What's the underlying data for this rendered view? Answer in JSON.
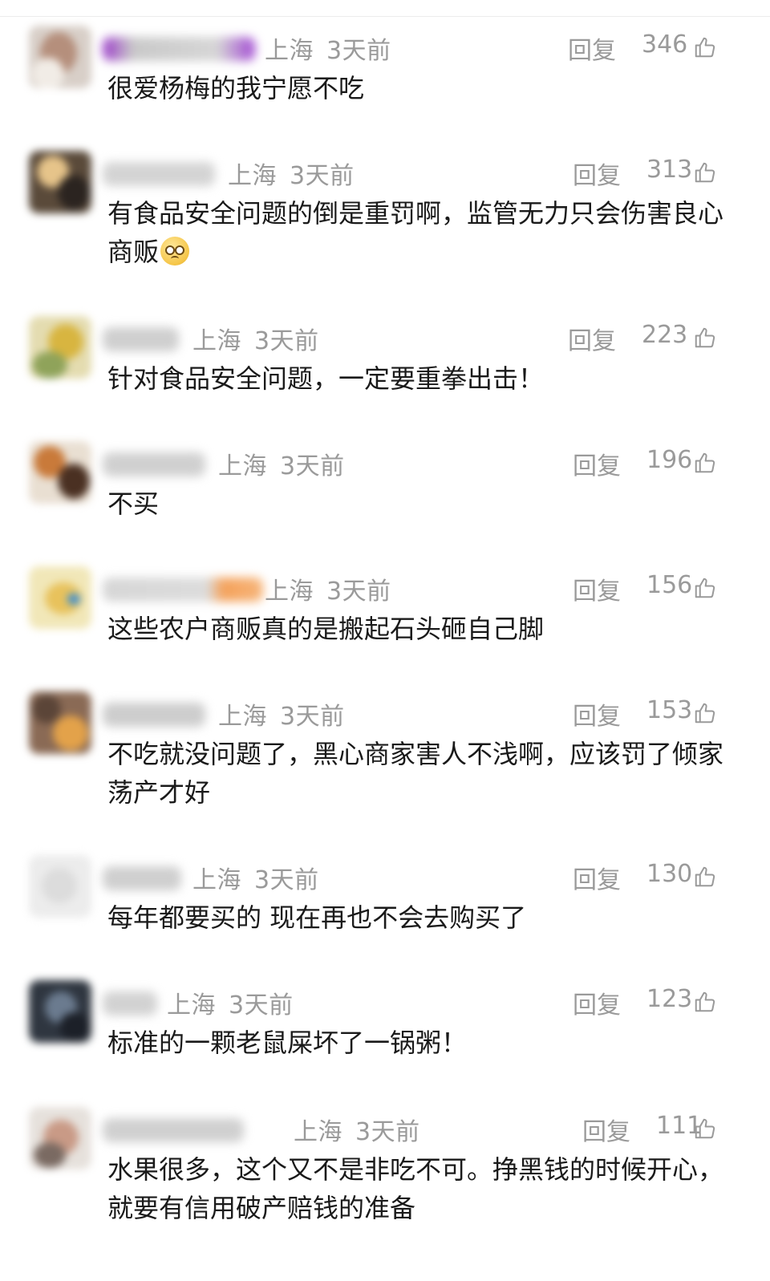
{
  "comments": [
    {
      "location": "上海",
      "time": "3天前",
      "reply_label": "回复",
      "likes": "346",
      "text": "很爱杨梅的我宁愿不吃"
    },
    {
      "location": "上海",
      "time": "3天前",
      "reply_label": "回复",
      "likes": "313",
      "text": "有食品安全问题的倒是重罚啊，监管无力只会伤害良心商贩"
    },
    {
      "location": "上海",
      "time": "3天前",
      "reply_label": "回复",
      "likes": "223",
      "text": "针对食品安全问题，一定要重拳出击！"
    },
    {
      "location": "上海",
      "time": "3天前",
      "reply_label": "回复",
      "likes": "196",
      "text": "不买"
    },
    {
      "location": "上海",
      "time": "3天前",
      "reply_label": "回复",
      "likes": "156",
      "text": "这些农户商贩真的是搬起石头砸自己脚"
    },
    {
      "location": "上海",
      "time": "3天前",
      "reply_label": "回复",
      "likes": "153",
      "text": "不吃就没问题了，黑心商家害人不浅啊，应该罚了倾家荡产才好"
    },
    {
      "location": "上海",
      "time": "3天前",
      "reply_label": "回复",
      "likes": "130",
      "text": "每年都要买的 现在再也不会去购买了"
    },
    {
      "location": "上海",
      "time": "3天前",
      "reply_label": "回复",
      "likes": "123",
      "text": "标准的一颗老鼠屎坏了一锅粥！"
    },
    {
      "location": "上海",
      "time": "3天前",
      "reply_label": "回复",
      "likes": "111",
      "text": "水果很多，这个又不是非吃不可。挣黑钱的时候开心，就要有信用破产赔钱的准备"
    }
  ],
  "icons": {
    "like": "thumbs-up-icon",
    "emoji": "pleading-face-emoji"
  },
  "colors": {
    "meta_text": "#9a9a9a",
    "body_text": "#1a1a1a"
  }
}
